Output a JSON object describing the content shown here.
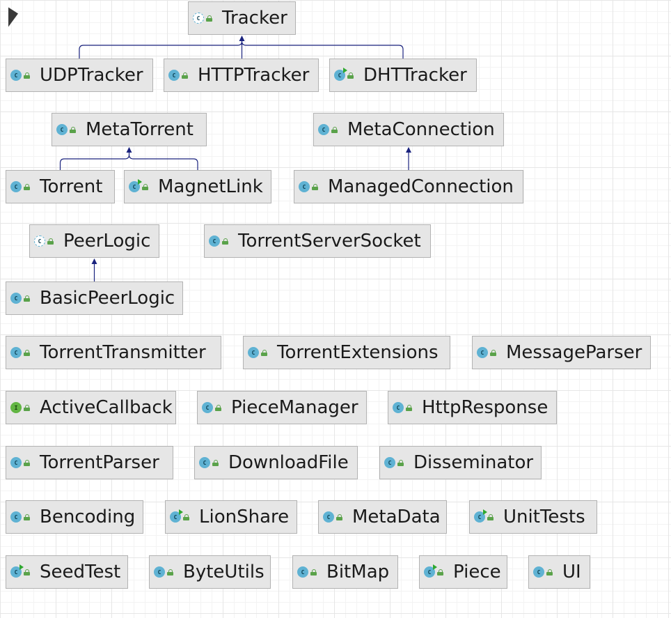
{
  "colors": {
    "node_fill": "#e6e6e6",
    "node_border": "#b2b2b2",
    "edge": "#1a237e",
    "class_icon": "#5fb2d3",
    "interface_icon": "#62b543",
    "lock": "#5aa24a"
  },
  "nodes": [
    {
      "id": "tracker",
      "label": "Tracker",
      "kind": "abstract"
    },
    {
      "id": "udptracker",
      "label": "UDPTracker",
      "kind": "class"
    },
    {
      "id": "httptracker",
      "label": "HTTPTracker",
      "kind": "class"
    },
    {
      "id": "dhttracker",
      "label": "DHTTracker",
      "kind": "runnable"
    },
    {
      "id": "metatorrent",
      "label": "MetaTorrent",
      "kind": "class"
    },
    {
      "id": "metaconnection",
      "label": "MetaConnection",
      "kind": "class"
    },
    {
      "id": "torrent",
      "label": "Torrent",
      "kind": "class"
    },
    {
      "id": "magnetlink",
      "label": "MagnetLink",
      "kind": "runnable"
    },
    {
      "id": "managedconnection",
      "label": "ManagedConnection",
      "kind": "class"
    },
    {
      "id": "peerlogic",
      "label": "PeerLogic",
      "kind": "abstract"
    },
    {
      "id": "torrentserversocket",
      "label": "TorrentServerSocket",
      "kind": "class"
    },
    {
      "id": "basicpeerlogic",
      "label": "BasicPeerLogic",
      "kind": "class"
    },
    {
      "id": "torrenttransmitter",
      "label": "TorrentTransmitter",
      "kind": "class"
    },
    {
      "id": "torrentextensions",
      "label": "TorrentExtensions",
      "kind": "class"
    },
    {
      "id": "messageparser",
      "label": "MessageParser",
      "kind": "class"
    },
    {
      "id": "activecallback",
      "label": "ActiveCallback",
      "kind": "interface"
    },
    {
      "id": "piecemanager",
      "label": "PieceManager",
      "kind": "class"
    },
    {
      "id": "httpresponse",
      "label": "HttpResponse",
      "kind": "class"
    },
    {
      "id": "torrentparser",
      "label": "TorrentParser",
      "kind": "class"
    },
    {
      "id": "downloadfile",
      "label": "DownloadFile",
      "kind": "class"
    },
    {
      "id": "disseminator",
      "label": "Disseminator",
      "kind": "class"
    },
    {
      "id": "bencoding",
      "label": "Bencoding",
      "kind": "class"
    },
    {
      "id": "lionshare",
      "label": "LionShare",
      "kind": "runnable"
    },
    {
      "id": "metadata",
      "label": "MetaData",
      "kind": "class"
    },
    {
      "id": "unittests",
      "label": "UnitTests",
      "kind": "runnable"
    },
    {
      "id": "seedtest",
      "label": "SeedTest",
      "kind": "runnable"
    },
    {
      "id": "byteutils",
      "label": "ByteUtils",
      "kind": "class"
    },
    {
      "id": "bitmap",
      "label": "BitMap",
      "kind": "class"
    },
    {
      "id": "piece",
      "label": "Piece",
      "kind": "runnable"
    },
    {
      "id": "ui",
      "label": "UI",
      "kind": "class"
    }
  ],
  "edges": [
    {
      "from": "udptracker",
      "to": "tracker",
      "type": "extends"
    },
    {
      "from": "httptracker",
      "to": "tracker",
      "type": "extends"
    },
    {
      "from": "dhttracker",
      "to": "tracker",
      "type": "extends"
    },
    {
      "from": "torrent",
      "to": "metatorrent",
      "type": "extends"
    },
    {
      "from": "magnetlink",
      "to": "metatorrent",
      "type": "extends"
    },
    {
      "from": "managedconnection",
      "to": "metaconnection",
      "type": "extends"
    },
    {
      "from": "basicpeerlogic",
      "to": "peerlogic",
      "type": "extends"
    }
  ]
}
